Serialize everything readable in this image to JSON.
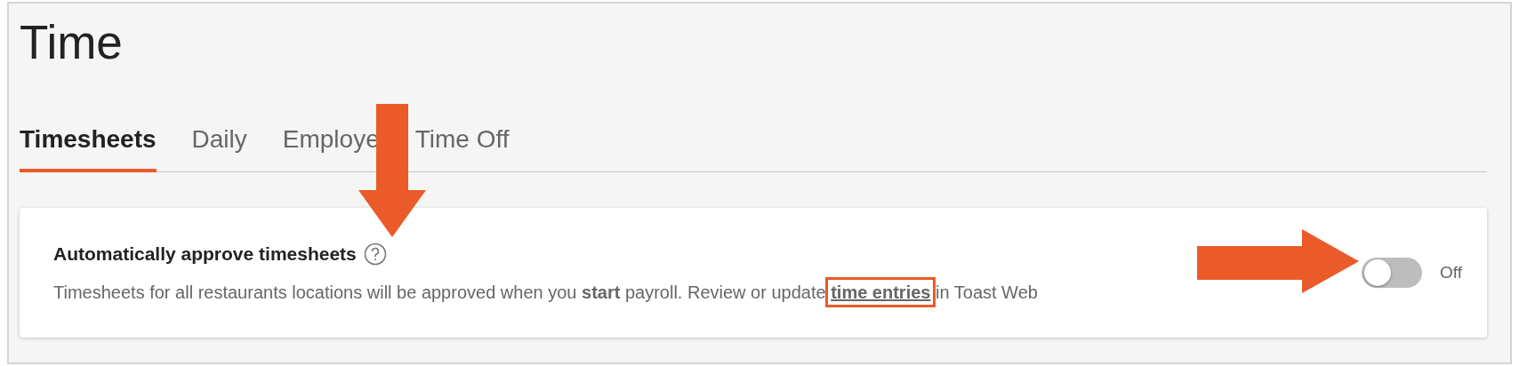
{
  "page": {
    "title": "Time"
  },
  "tabs": [
    {
      "label": "Timesheets",
      "selected": true
    },
    {
      "label": "Daily",
      "selected": false
    },
    {
      "label": "Employe",
      "selected": false
    },
    {
      "label": "Time Off",
      "selected": false
    }
  ],
  "setting": {
    "title": "Automatically approve timesheets",
    "description_before": "Timesheets for all restaurants locations will be approved when you **start** payroll. Review or update",
    "link": "time entries",
    "description_after": "in Toast Web",
    "on": false,
    "state_label": "Off"
  },
  "annotations": [
    {
      "kind": "arrow-down"
    },
    {
      "kind": "arrow-right"
    },
    {
      "kind": "highlight"
    }
  ]
}
